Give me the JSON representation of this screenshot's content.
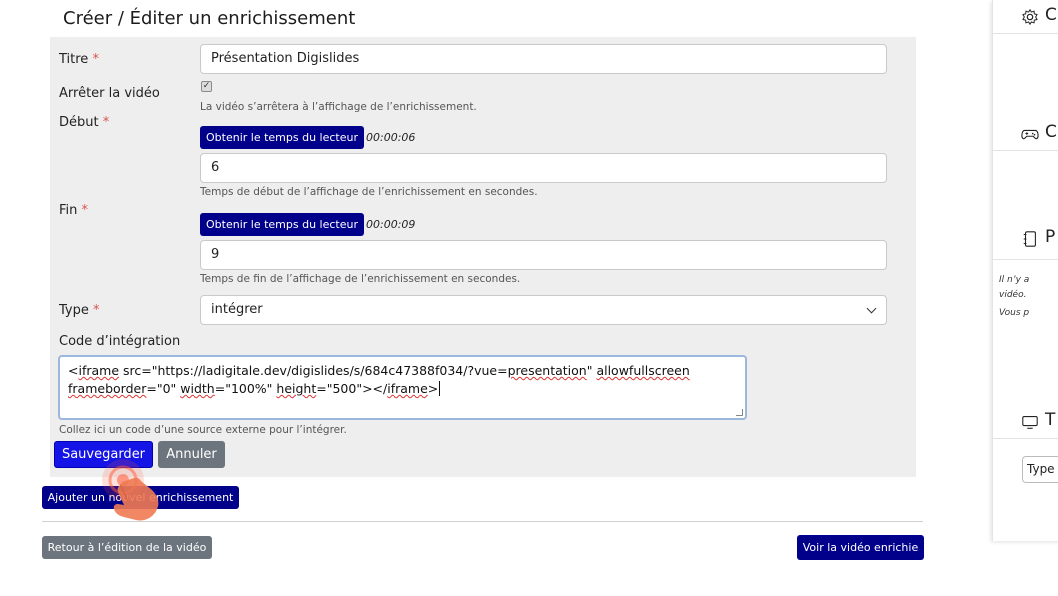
{
  "page": {
    "title": "Créer / Éditer un enrichissement"
  },
  "form": {
    "titre": {
      "label": "Titre",
      "required_mark": "*",
      "value": "Présentation Digislides"
    },
    "stop_video": {
      "label": "Arrêter la vidéo",
      "checked": true,
      "help": "La vidéo s’arrêtera à l’affichage de l’enrichissement."
    },
    "debut": {
      "label": "Début",
      "required_mark": "*",
      "button": "Obtenir le temps du lecteur",
      "player_time": "00:00:06",
      "value": "6",
      "help": "Temps de début de l’affichage de l’enrichissement en secondes."
    },
    "fin": {
      "label": "Fin",
      "required_mark": "*",
      "button": "Obtenir le temps du lecteur",
      "player_time": "00:00:09",
      "value": "9",
      "help": "Temps de fin de l’affichage de l’enrichissement en secondes."
    },
    "type": {
      "label": "Type",
      "required_mark": "*",
      "value": "intégrer"
    },
    "embed": {
      "label": "Code d’intégration",
      "line1": {
        "t1": "<",
        "w1": "iframe",
        "t2": " src=\"https://ladigitale.dev/digislides/s/684c47388f034/?vue=",
        "w2": "presentation",
        "t3": "\" ",
        "w3": "allowfullscreen"
      },
      "line2": {
        "w1": "frameborder",
        "t1": "=\"0\" ",
        "w2": "width",
        "t2": "=\"100%\" ",
        "w3": "height",
        "t3": "=\"500\"></",
        "w4": "iframe",
        "t4": ">"
      },
      "help": "Collez ici un code d’une source externe pour l’intégrer."
    },
    "save_label": "Sauvegarder",
    "cancel_label": "Annuler"
  },
  "actions": {
    "add_label": "Ajouter un nouvel enrichissement",
    "back_label": "Retour à l’édition de la vidéo",
    "view_label": "Voir la vidéo enrichie"
  },
  "sidebar": {
    "sections": [
      {
        "icon": "gear-icon",
        "cut_text": "C"
      },
      {
        "icon": "gamepad-icon",
        "cut_text": "C"
      },
      {
        "icon": "notebook-icon",
        "cut_text": "P"
      },
      {
        "icon": "monitor-icon",
        "cut_text": "T"
      }
    ],
    "note_line1": "Il n’y a",
    "note_line2": "vidéo.",
    "note_line3": "Vous p",
    "select_value": "Type"
  },
  "colors": {
    "navy": "#00008b",
    "save_blue": "#1414e6",
    "gray_btn": "#6c757d",
    "panel_bg": "#eeeeee",
    "required": "#d9534f"
  }
}
